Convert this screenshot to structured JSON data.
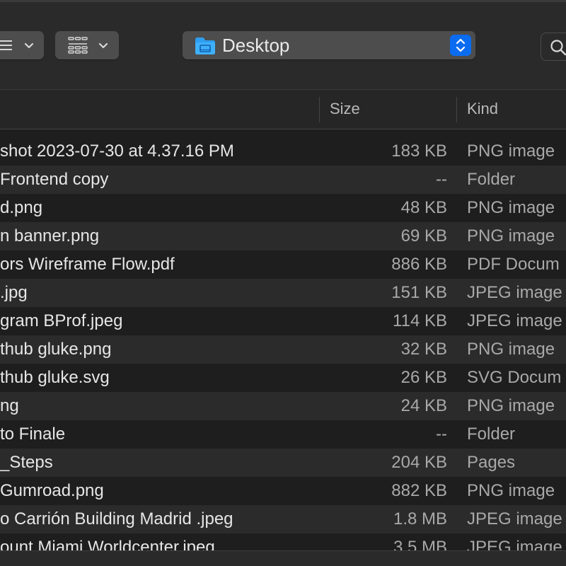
{
  "toolbar": {
    "path_label": "Desktop",
    "accent": "#0a6cf0"
  },
  "columns": {
    "size": "Size",
    "kind": "Kind"
  },
  "files": [
    {
      "name": "shot 2023-07-30 at 4.37.16 PM",
      "size": "183 KB",
      "kind": "PNG image"
    },
    {
      "name": "Frontend copy",
      "size": "--",
      "kind": "Folder"
    },
    {
      "name": "d.png",
      "size": "48 KB",
      "kind": "PNG image"
    },
    {
      "name": "n banner.png",
      "size": "69 KB",
      "kind": "PNG image"
    },
    {
      "name": "ors Wireframe Flow.pdf",
      "size": "886 KB",
      "kind": "PDF Docum"
    },
    {
      "name": ".jpg",
      "size": "151 KB",
      "kind": "JPEG image"
    },
    {
      "name": "gram BProf.jpeg",
      "size": "114 KB",
      "kind": "JPEG image"
    },
    {
      "name": "thub gluke.png",
      "size": "32 KB",
      "kind": "PNG image"
    },
    {
      "name": "thub gluke.svg",
      "size": "26 KB",
      "kind": "SVG Docum"
    },
    {
      "name": "ng",
      "size": "24 KB",
      "kind": "PNG image"
    },
    {
      "name": "to Finale",
      "size": "--",
      "kind": "Folder"
    },
    {
      "name": "_Steps",
      "size": "204 KB",
      "kind": "Pages"
    },
    {
      "name": "Gumroad.png",
      "size": "882 KB",
      "kind": "PNG image"
    },
    {
      "name": "o Carrión Building Madrid .jpeg",
      "size": "1.8 MB",
      "kind": "JPEG image"
    },
    {
      "name": "ount Miami Worldcenter.jpeg",
      "size": "3.5 MB",
      "kind": "JPEG image"
    }
  ]
}
